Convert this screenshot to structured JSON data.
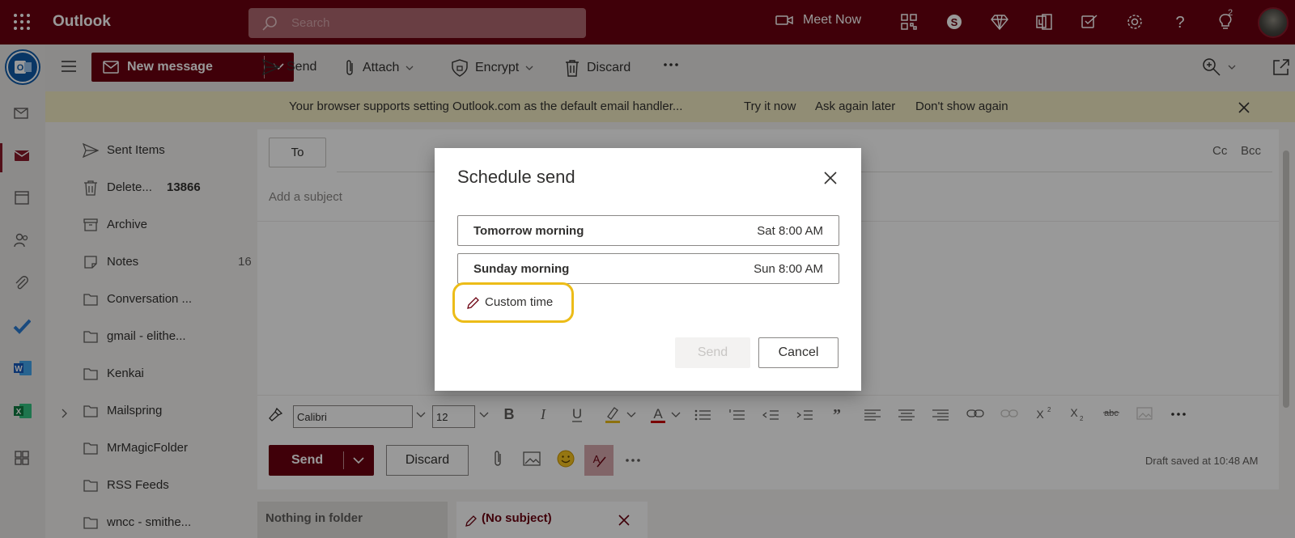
{
  "app": {
    "title": "Outlook"
  },
  "search": {
    "placeholder": "Search"
  },
  "topbar": {
    "meet_now": "Meet Now",
    "tips_badge": "2"
  },
  "toolbar": {
    "new_message": "New message",
    "send": "Send",
    "attach": "Attach",
    "encrypt": "Encrypt",
    "discard": "Discard"
  },
  "banner": {
    "message": "Your browser supports setting Outlook.com as the default email handler...",
    "try_now": "Try it now",
    "ask_later": "Ask again later",
    "dont_show": "Don't show again"
  },
  "folders": [
    {
      "label": "Sent Items",
      "count": "",
      "icon": "send-icon"
    },
    {
      "label": "Delete...",
      "count": "13866",
      "icon": "trash-icon"
    },
    {
      "label": "Archive",
      "count": "",
      "icon": "archive-icon"
    },
    {
      "label": "Notes",
      "count": "16",
      "icon": "note-icon"
    },
    {
      "label": "Conversation ...",
      "count": "",
      "icon": "folder-icon"
    },
    {
      "label": "gmail - elithe...",
      "count": "",
      "icon": "folder-icon"
    },
    {
      "label": "Kenkai",
      "count": "",
      "icon": "folder-icon"
    },
    {
      "label": "Mailspring",
      "count": "",
      "icon": "folder-icon"
    },
    {
      "label": "MrMagicFolder",
      "count": "",
      "icon": "folder-icon"
    },
    {
      "label": "RSS Feeds",
      "count": "",
      "icon": "folder-icon"
    },
    {
      "label": "wncc - smithe...",
      "count": "",
      "icon": "folder-icon"
    }
  ],
  "compose": {
    "to_label": "To",
    "cc": "Cc",
    "bcc": "Bcc",
    "subject_placeholder": "Add a subject",
    "font": "Calibri",
    "font_size": "12",
    "send": "Send",
    "discard": "Discard",
    "draft_status": "Draft saved at 10:48 AM"
  },
  "tabs": {
    "folder_tab": "Nothing in folder",
    "draft_tab": "(No subject)"
  },
  "dialog": {
    "title": "Schedule send",
    "options": [
      {
        "label": "Tomorrow morning",
        "time": "Sat 8:00 AM"
      },
      {
        "label": "Sunday morning",
        "time": "Sun 8:00 AM"
      }
    ],
    "custom_time": "Custom time",
    "send": "Send",
    "cancel": "Cancel"
  },
  "colors": {
    "brand": "#6b0010",
    "highlight": "#ecbc18",
    "banner": "#f2ecc4"
  }
}
